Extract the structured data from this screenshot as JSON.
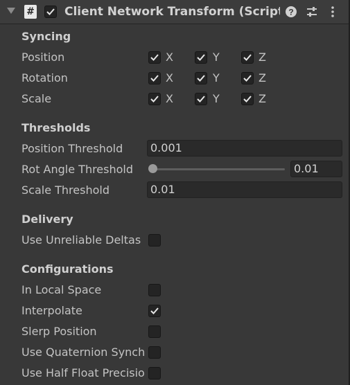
{
  "component": {
    "title": "Client Network Transform (Script)",
    "script_icon": "#",
    "enabled": true,
    "icons": [
      "foldout-arrow-icon",
      "script-icon",
      "help-icon",
      "preset-icon",
      "context-menu-icon"
    ]
  },
  "syncing": {
    "heading": "Syncing",
    "rows": [
      {
        "label": "Position",
        "x": "X",
        "y": "Y",
        "z": "Z"
      },
      {
        "label": "Rotation",
        "x": "X",
        "y": "Y",
        "z": "Z"
      },
      {
        "label": "Scale",
        "x": "X",
        "y": "Y",
        "z": "Z"
      }
    ]
  },
  "thresholds": {
    "heading": "Thresholds",
    "position_label": "Position Threshold",
    "position_value": "0.001",
    "rot_label": "Rot Angle Threshold",
    "rot_value": "0.01",
    "scale_label": "Scale Threshold",
    "scale_value": "0.01"
  },
  "delivery": {
    "heading": "Delivery",
    "unreliable_label": "Use Unreliable Deltas",
    "unreliable_checked": false
  },
  "configurations": {
    "heading": "Configurations",
    "items": [
      {
        "label": "In Local Space",
        "checked": false
      },
      {
        "label": "Interpolate",
        "checked": true
      },
      {
        "label": "Slerp Position",
        "checked": false
      },
      {
        "label": "Use Quaternion Synchronization",
        "checked": false
      },
      {
        "label": "Use Half Float Precision",
        "checked": false
      }
    ]
  },
  "colors": {
    "background": "#383838",
    "header": "#3c3c3c",
    "field": "#2a2a2a",
    "text": "#c4c4c4"
  }
}
